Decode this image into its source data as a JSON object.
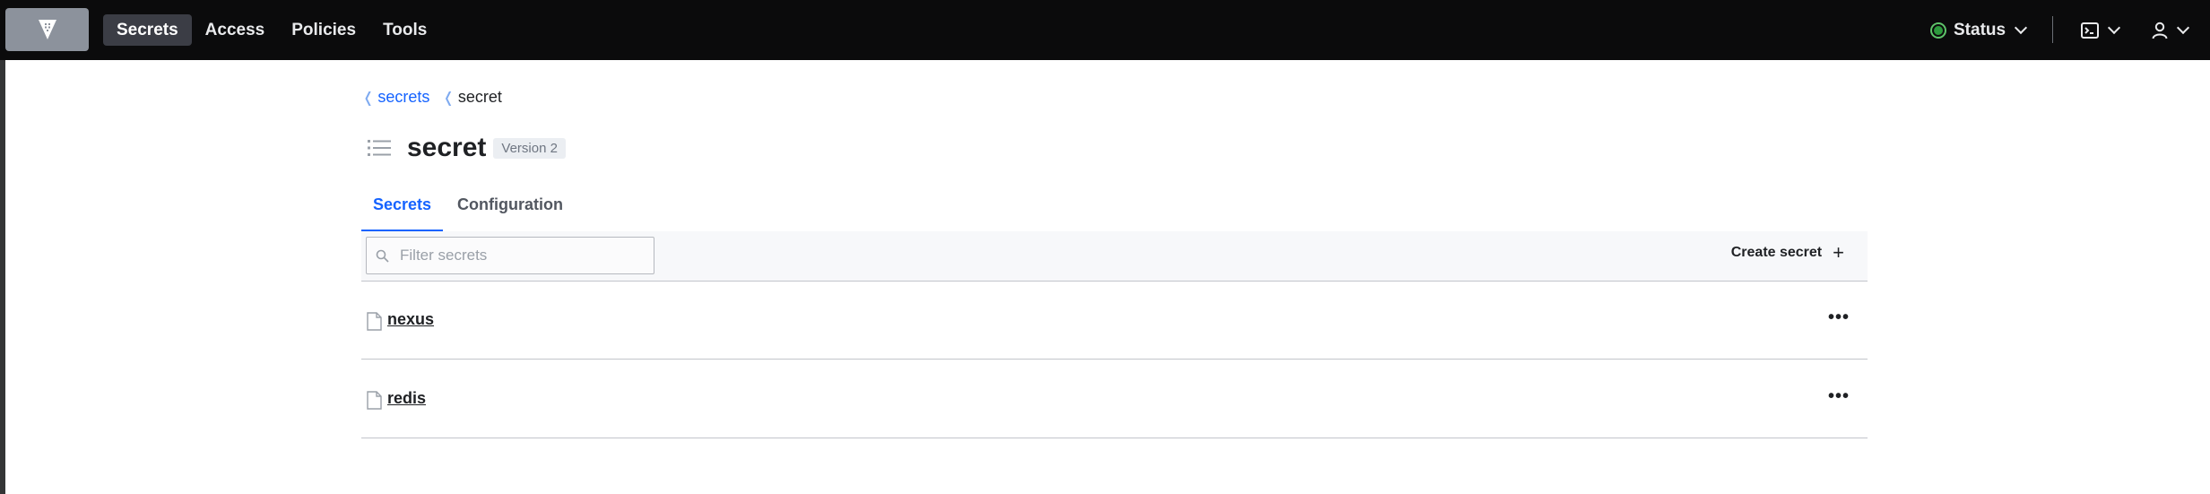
{
  "nav": {
    "items": [
      {
        "label": "Secrets",
        "active": true
      },
      {
        "label": "Access",
        "active": false
      },
      {
        "label": "Policies",
        "active": false
      },
      {
        "label": "Tools",
        "active": false
      }
    ],
    "status_label": "Status",
    "status_color": "#2d9a3d"
  },
  "breadcrumb": {
    "items": [
      {
        "label": "secrets",
        "link": true
      },
      {
        "label": "secret",
        "link": false
      }
    ]
  },
  "page": {
    "title": "secret",
    "version_badge": "Version 2"
  },
  "tabs": [
    {
      "label": "Secrets",
      "active": true
    },
    {
      "label": "Configuration",
      "active": false
    }
  ],
  "toolbar": {
    "filter_placeholder": "Filter secrets",
    "filter_value": "",
    "create_label": "Create secret"
  },
  "secrets": [
    {
      "name": "nexus"
    },
    {
      "name": "redis"
    }
  ],
  "colors": {
    "accent": "#1563ff",
    "topbar": "#0b0b0c"
  }
}
